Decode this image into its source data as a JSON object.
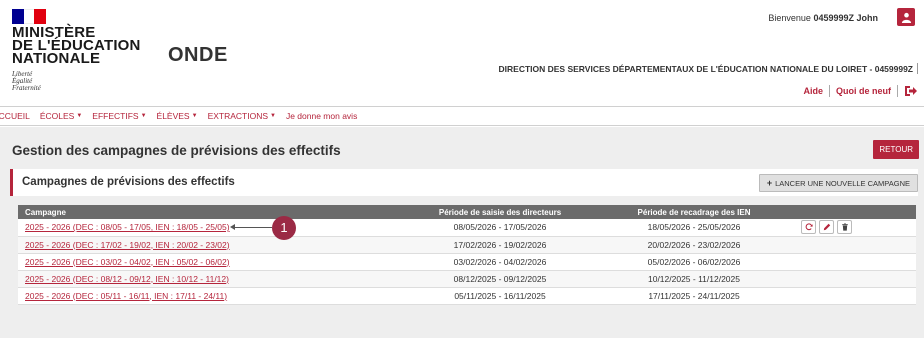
{
  "header": {
    "ministry_lines": [
      "MINISTÈRE",
      "DE L'ÉDUCATION",
      "NATIONALE"
    ],
    "motto_lines": [
      "Liberté",
      "Égalité",
      "Fraternité"
    ],
    "app_name": "ONDE",
    "welcome_prefix": "Bienvenue",
    "user_id": "0459999Z John",
    "direction": "DIRECTION DES SERVICES DÉPARTEMENTAUX DE L'ÉDUCATION NATIONALE DU LOIRET - 0459999Z",
    "help_label": "Aide",
    "news_label": "Quoi de neuf"
  },
  "nav": {
    "items": [
      {
        "label": "ACCUEIL",
        "caret": false
      },
      {
        "label": "ÉCOLES",
        "caret": true
      },
      {
        "label": "EFFECTIFS",
        "caret": true
      },
      {
        "label": "ÉLÈVES",
        "caret": true
      },
      {
        "label": "EXTRACTIONS",
        "caret": true
      },
      {
        "label": "Je donne mon avis",
        "caret": false
      }
    ],
    "caret_glyph": "▼"
  },
  "page": {
    "title": "Gestion des campagnes de prévisions des effectifs",
    "back_label": "RETOUR"
  },
  "panel": {
    "title": "Campagnes de prévisions des effectifs",
    "new_campaign_label": "LANCER UNE NOUVELLE CAMPAGNE"
  },
  "table": {
    "headers": [
      "Campagne",
      "Période de saisie des directeurs",
      "Période de recadrage des IEN",
      ""
    ],
    "rows": [
      {
        "campagne": "2025 - 2026 (DEC : 08/05 - 17/05, IEN : 18/05 - 25/05)",
        "saisie": "08/05/2026 - 17/05/2026",
        "recadrage": "18/05/2026 - 25/05/2026"
      },
      {
        "campagne": "2025 - 2026 (DEC : 17/02 - 19/02, IEN : 20/02 - 23/02)",
        "saisie": "17/02/2026 - 19/02/2026",
        "recadrage": "20/02/2026 - 23/02/2026"
      },
      {
        "campagne": "2025 - 2026 (DEC : 03/02 - 04/02, IEN : 05/02 - 06/02)",
        "saisie": "03/02/2026 - 04/02/2026",
        "recadrage": "05/02/2026 - 06/02/2026"
      },
      {
        "campagne": "2025 - 2026 (DEC : 08/12 - 09/12, IEN : 10/12 - 11/12)",
        "saisie": "08/12/2025 - 09/12/2025",
        "recadrage": "10/12/2025 - 11/12/2025"
      },
      {
        "campagne": "2025 - 2026 (DEC : 05/11 - 16/11, IEN : 17/11 - 24/11)",
        "saisie": "05/11/2025 - 16/11/2025",
        "recadrage": "17/11/2025 - 24/11/2025"
      }
    ]
  },
  "annotation": {
    "badge": "1"
  },
  "colors": {
    "accent": "#b5253c",
    "flag_blue": "#000091",
    "flag_red": "#e1000f",
    "table_header": "#6b6b6b"
  },
  "icons": [
    "user-icon",
    "logout-icon",
    "refresh-icon",
    "pencil-icon",
    "trash-icon"
  ]
}
